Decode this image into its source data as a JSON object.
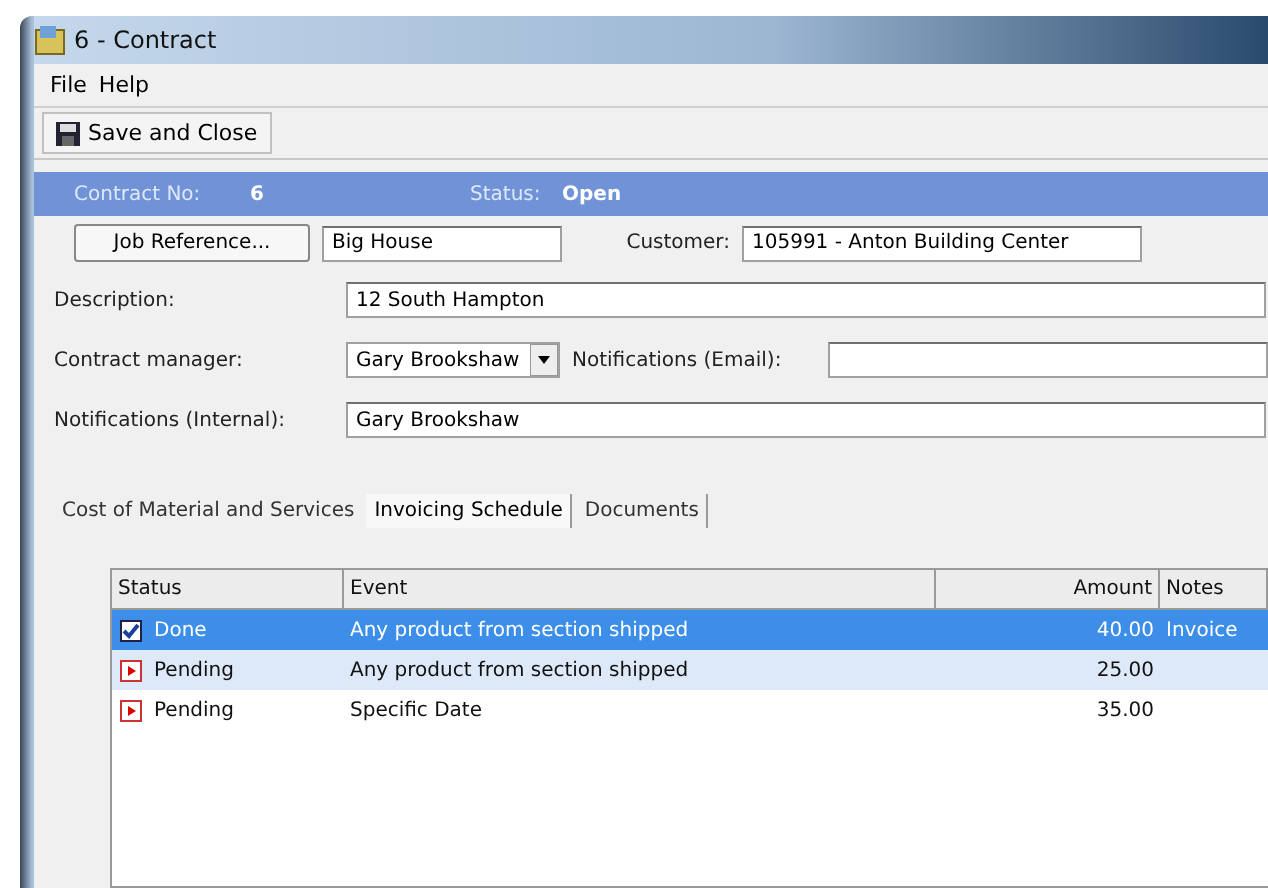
{
  "window": {
    "title": "6 - Contract"
  },
  "menu": [
    "File",
    "Help"
  ],
  "toolbar": {
    "save_button": "Save and Close"
  },
  "header": {
    "contract_label": "Contract No:",
    "contract_value": "6",
    "status_label": "Status:",
    "status_value": "Open"
  },
  "form": {
    "job_reference_button": "Job Reference...",
    "job_reference": "Big House",
    "customer_label": "Customer:",
    "customer": "105991 - Anton Building Center",
    "description_label": "Description:",
    "description": "12 South Hampton",
    "manager_label": "Contract manager:",
    "manager": "Gary Brookshaw",
    "email_label": "Notifications (Email):",
    "internal_label": "Notifications (Internal):",
    "internal": "Gary Brookshaw"
  },
  "tabs": [
    {
      "label": "Cost of Material and Services",
      "selected": false
    },
    {
      "label": "Invoicing Schedule",
      "selected": true
    },
    {
      "label": "Documents",
      "selected": false
    }
  ],
  "table": {
    "columns": [
      "Status",
      "Event",
      "Amount",
      "Notes"
    ],
    "rows": [
      {
        "kind": "done",
        "status": "Done",
        "event": "Any product from section shipped",
        "amount": "40.00",
        "notes": "Invoice",
        "selected": true
      },
      {
        "kind": "pending",
        "status": "Pending",
        "event": "Any product from section shipped",
        "amount": "25.00",
        "notes": "",
        "selected": false
      },
      {
        "kind": "pending",
        "status": "Pending",
        "event": "Specific Date",
        "amount": "35.00",
        "notes": "",
        "selected": false
      }
    ]
  }
}
